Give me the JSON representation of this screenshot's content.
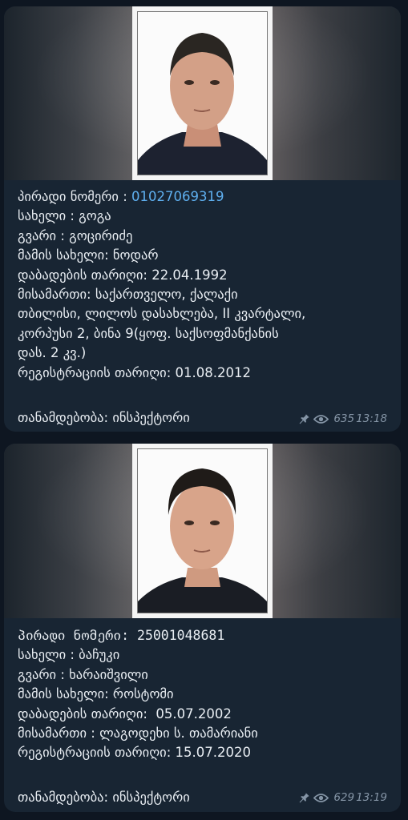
{
  "messages": [
    {
      "caption": {
        "personal_number_label": "პირადი ნომერი : ",
        "personal_number": "01027069319",
        "name": "სახელი : გოგა",
        "surname": "გვარი : გოცირიძე",
        "father_name": "მამის სახელი: ნოდარ",
        "birth_date": "დაბადების თარიღი: 22.04.1992",
        "address_1": "მისამართი: საქართველო, ქალაქი",
        "address_2": "თბილისი, ლილოს დასახლება, II კვარტალი,",
        "address_3": "კორპუსი 2, ბინა 9(ყოფ. საქსოფმანქანის",
        "address_4": "დას. 2 კვ.)",
        "registration_date": "რეგისტრაციის თარიღი: 01.08.2012",
        "position": "თანამდებობა: ინსპექტორი"
      },
      "meta": {
        "pin_icon": "pin-icon",
        "views_icon": "eye-icon",
        "views": "635",
        "time": "13:18"
      }
    },
    {
      "caption": {
        "personal_number": "პირადი ნომერი: 25001048681",
        "name": "სახელი : ბაჩუკი",
        "surname": "გვარი : ხარაიშვილი",
        "father_name": "მამის სახელი: როსტომი",
        "birth_date": "დაბადების თარიღი:  05.07.2002",
        "address": "მისამართი : ლაგოდეხი ს. თამარიანი",
        "registration_date": "რეგისტრაციის თარიღი: 15.07.2020",
        "position": "თანამდებობა: ინსპექტორი"
      },
      "meta": {
        "pin_icon": "pin-icon",
        "views_icon": "eye-icon",
        "views": "629",
        "time": "13:19"
      }
    }
  ],
  "colors": {
    "background": "#0e1621",
    "bubble": "#182533",
    "text": "#e9eef3",
    "link": "#5fb0f0",
    "meta": "#8595a6"
  }
}
